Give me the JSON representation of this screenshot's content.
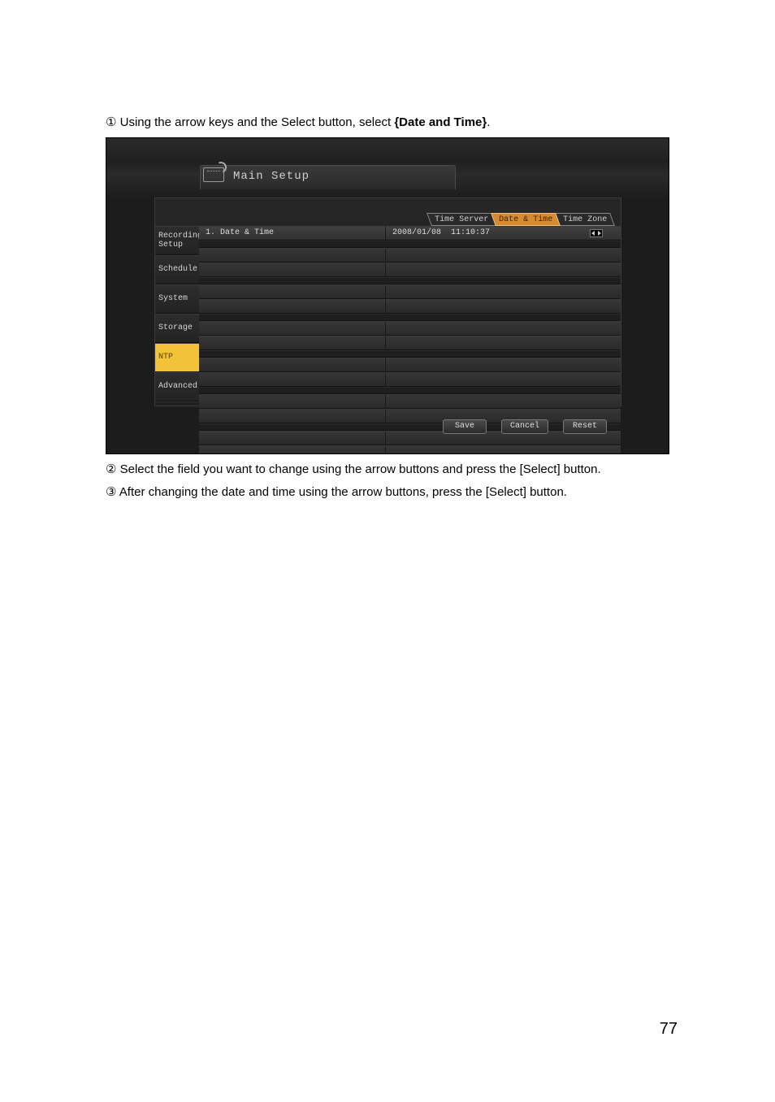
{
  "instructions": {
    "step1_prefix": "① Using the arrow keys and the Select button, select ",
    "step1_bold": "{Date and Time}",
    "step1_suffix": ".",
    "step2": "② Select the field you want to change using the arrow buttons and press the [Select] button.",
    "step3": "③ After changing the date and time using the arrow buttons, press the [Select] button."
  },
  "ui": {
    "title": "Main Setup",
    "tabs": {
      "time_server": "Time Server",
      "date_time": "Date & Time",
      "time_zone": "Time Zone",
      "active": "date_time"
    },
    "sidebar": [
      {
        "key": "recording_setup",
        "label": "Recording\nSetup"
      },
      {
        "key": "schedule",
        "label": "Schedule"
      },
      {
        "key": "system",
        "label": "System"
      },
      {
        "key": "storage",
        "label": "Storage"
      },
      {
        "key": "ntp",
        "label": "NTP",
        "active": true
      },
      {
        "key": "advanced",
        "label": "Advanced"
      }
    ],
    "row1": {
      "label": "1. Date & Time",
      "date": "2008/01/08",
      "time": "11:10:37"
    },
    "buttons": {
      "save": "Save",
      "cancel": "Cancel",
      "reset": "Reset"
    }
  },
  "page_number": "77"
}
